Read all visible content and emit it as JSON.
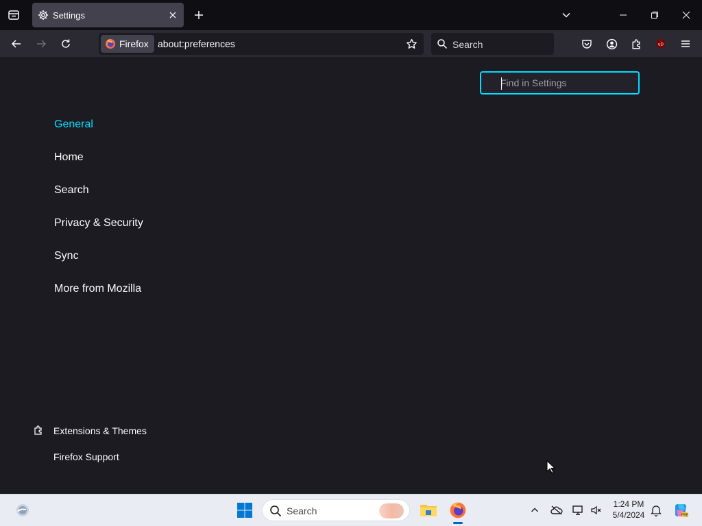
{
  "tabbar": {
    "tab_title": "Settings",
    "list_tabs_icon": "list-all-tabs-icon",
    "close_icon": "close-icon",
    "new_tab_icon": "plus-icon"
  },
  "navbar": {
    "identity_label": "Firefox",
    "url": "about:preferences",
    "search_placeholder": "Search"
  },
  "settings": {
    "find_placeholder": "Find in Settings",
    "categories": [
      "General",
      "Home",
      "Search",
      "Privacy & Security",
      "Sync",
      "More from Mozilla"
    ],
    "selected": "General",
    "footer": {
      "extensions": "Extensions & Themes",
      "support": "Firefox Support"
    }
  },
  "taskbar": {
    "search_placeholder": "Search",
    "time": "1:24 PM",
    "date": "5/4/2024"
  },
  "colors": {
    "accent": "#00ddff",
    "background": "#1c1b22",
    "toolbar": "#2b2a33"
  }
}
